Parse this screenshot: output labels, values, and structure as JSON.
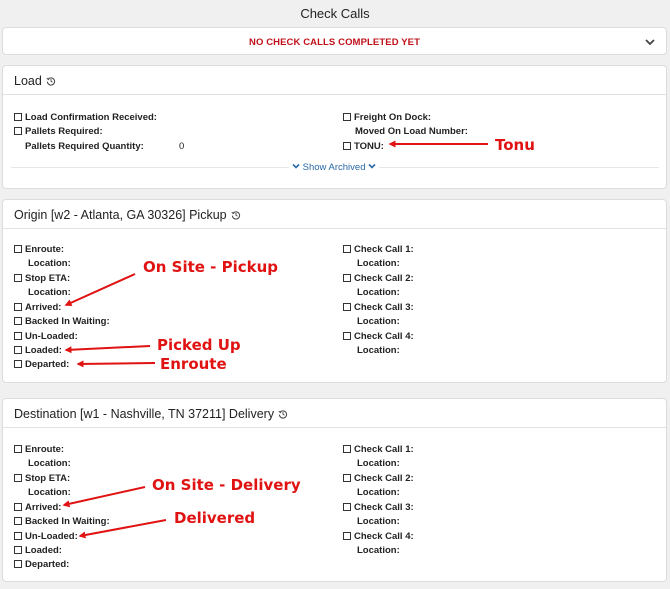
{
  "page_title": "Check Calls",
  "banner": {
    "text": "NO CHECK CALLS COMPLETED YET",
    "icon": "chevron-down-icon"
  },
  "load": {
    "title": "Load",
    "history_icon": "history-icon",
    "left": [
      "Load Confirmation Received:",
      "Pallets Required:"
    ],
    "pallets_qty_label": "Pallets Required Quantity:",
    "pallets_qty_value": "0",
    "right": [
      "Freight On Dock:",
      "TONU:"
    ],
    "moved_on_label": "Moved On Load Number:",
    "show_archived": "Show Archived"
  },
  "origin": {
    "title": "Origin [w2 - Atlanta, GA 30326] Pickup",
    "enroute": "Enroute:",
    "location": "Location:",
    "stop_eta": "Stop ETA:",
    "arrived": "Arrived:",
    "backed_in": "Backed In Waiting:",
    "unloaded": "Un-Loaded:",
    "loaded": "Loaded:",
    "departed": "Departed:",
    "check_calls": [
      "Check Call 1:",
      "Check Call 2:",
      "Check Call 3:",
      "Check Call 4:"
    ]
  },
  "destination": {
    "title": "Destination [w1 - Nashville, TN 37211] Delivery",
    "enroute": "Enroute:",
    "location": "Location:",
    "stop_eta": "Stop ETA:",
    "arrived": "Arrived:",
    "backed_in": "Backed In Waiting:",
    "unloaded": "Un-Loaded:",
    "loaded": "Loaded:",
    "departed": "Departed:",
    "check_calls": [
      "Check Call 1:",
      "Check Call 2:",
      "Check Call 3:",
      "Check Call 4:"
    ]
  },
  "annotations": {
    "tonu": "Tonu",
    "on_site_pickup": "On Site - Pickup",
    "picked_up": "Picked Up",
    "enroute": "Enroute",
    "on_site_delivery": "On Site - Delivery",
    "delivered": "Delivered",
    "color": "#e01212"
  }
}
